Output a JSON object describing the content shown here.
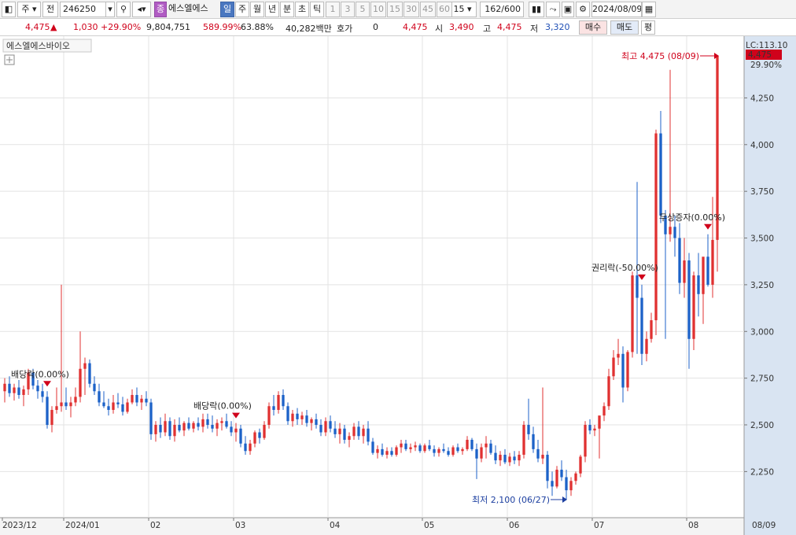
{
  "toolbar": {
    "market": "주",
    "prev": "전",
    "code": "246250",
    "tag": "종",
    "name": "에스엘에스",
    "periods": [
      "일",
      "주",
      "월",
      "년",
      "분",
      "초",
      "틱"
    ],
    "active_period": "일",
    "intervals": [
      "1",
      "3",
      "5",
      "10",
      "15",
      "30",
      "45",
      "60"
    ],
    "interval_select": "15",
    "count": "162/600",
    "date": "2024/08/09"
  },
  "quote": {
    "price": "4,475",
    "change": "1,030",
    "change_pct": "+29.90%",
    "volume": "9,804,751",
    "volume_ratio": "589.99%",
    "turnover": "63.88%",
    "amount": "40,282백만",
    "hoga_label": "호가",
    "hoga_value": "0",
    "last": "4,475",
    "open_label": "시",
    "open": "3,490",
    "high_label": "고",
    "high": "4,475",
    "low_label": "저",
    "low": "3,320",
    "buy_btn": "매수",
    "sell_btn": "매도",
    "flat_btn": "평"
  },
  "chart_title": "에스엘에스바이오",
  "colors": {
    "up": "#e03131",
    "down": "#1c62c8",
    "grid": "#e3e3e3",
    "axis_bg": "#d9e4f2"
  },
  "chart_data": {
    "type": "candlestick",
    "y_ticks": [
      "4,250",
      "4,000",
      "3,750",
      "3,500",
      "3,250",
      "3,000",
      "2,750",
      "2,500",
      "2,250"
    ],
    "y_tick_values": [
      4250,
      4000,
      3750,
      3500,
      3250,
      3000,
      2750,
      2500,
      2250
    ],
    "ylim": [
      2000,
      4500
    ],
    "x_labels": [
      "2023/12",
      "2024/01",
      "02",
      "03",
      "04",
      "05",
      "06",
      "07",
      "08",
      "08/09"
    ],
    "lc_label": "LC:113.10",
    "last_price": "4,475",
    "last_pct": "29.90%",
    "high_note": "최고 4,475 (08/09)",
    "low_note": "최저 2,100 (06/27)",
    "events": [
      {
        "label": "배당락(0.00%)",
        "date": "2023/12/27"
      },
      {
        "label": "배당락(0.00%)",
        "date": "2024/02/28"
      },
      {
        "label": "권리락(-50.00%)",
        "date": "2024/07/17"
      },
      {
        "label": "무상증자(0.00%)",
        "date": "2024/08/05"
      }
    ],
    "months": [
      "2023/12",
      "2024/01",
      "02",
      "03",
      "04",
      "05",
      "06",
      "07",
      "08"
    ],
    "ohlc": [
      [
        2680,
        2750,
        2620,
        2720
      ],
      [
        2720,
        2760,
        2650,
        2670
      ],
      [
        2670,
        2720,
        2630,
        2700
      ],
      [
        2700,
        2740,
        2640,
        2660
      ],
      [
        2660,
        2710,
        2600,
        2690
      ],
      [
        2690,
        2800,
        2660,
        2780
      ],
      [
        2780,
        2800,
        2690,
        2710
      ],
      [
        2710,
        2740,
        2640,
        2680
      ],
      [
        2680,
        2720,
        2620,
        2650
      ],
      [
        2650,
        2680,
        2480,
        2500
      ],
      [
        2500,
        2600,
        2460,
        2580
      ],
      [
        2580,
        2700,
        2560,
        2600
      ],
      [
        2600,
        3250,
        2570,
        2620
      ],
      [
        2620,
        2700,
        2580,
        2600
      ],
      [
        2600,
        2650,
        2540,
        2620
      ],
      [
        2620,
        2700,
        2600,
        2650
      ],
      [
        2650,
        3000,
        2620,
        2800
      ],
      [
        2800,
        2860,
        2660,
        2830
      ],
      [
        2830,
        2850,
        2700,
        2720
      ],
      [
        2720,
        2760,
        2660,
        2680
      ],
      [
        2680,
        2720,
        2600,
        2620
      ],
      [
        2620,
        2680,
        2590,
        2600
      ],
      [
        2600,
        2640,
        2550,
        2580
      ],
      [
        2580,
        2660,
        2560,
        2620
      ],
      [
        2620,
        2670,
        2590,
        2610
      ],
      [
        2610,
        2650,
        2550,
        2570
      ],
      [
        2570,
        2640,
        2560,
        2620
      ],
      [
        2620,
        2690,
        2610,
        2660
      ],
      [
        2660,
        2700,
        2600,
        2620
      ],
      [
        2620,
        2660,
        2580,
        2640
      ],
      [
        2640,
        2680,
        2600,
        2620
      ],
      [
        2620,
        2640,
        2420,
        2450
      ],
      [
        2450,
        2520,
        2410,
        2500
      ],
      [
        2500,
        2540,
        2430,
        2460
      ],
      [
        2460,
        2560,
        2440,
        2520
      ],
      [
        2520,
        2540,
        2420,
        2440
      ],
      [
        2440,
        2530,
        2410,
        2500
      ],
      [
        2500,
        2540,
        2460,
        2470
      ],
      [
        2470,
        2520,
        2440,
        2510
      ],
      [
        2510,
        2540,
        2470,
        2480
      ],
      [
        2480,
        2520,
        2460,
        2510
      ],
      [
        2510,
        2540,
        2470,
        2490
      ],
      [
        2490,
        2560,
        2460,
        2530
      ],
      [
        2530,
        2560,
        2480,
        2500
      ],
      [
        2500,
        2550,
        2460,
        2480
      ],
      [
        2480,
        2530,
        2440,
        2510
      ],
      [
        2510,
        2540,
        2470,
        2520
      ],
      [
        2520,
        2560,
        2480,
        2490
      ],
      [
        2490,
        2520,
        2440,
        2460
      ],
      [
        2460,
        2510,
        2410,
        2480
      ],
      [
        2480,
        2500,
        2380,
        2400
      ],
      [
        2400,
        2440,
        2340,
        2360
      ],
      [
        2360,
        2420,
        2340,
        2400
      ],
      [
        2400,
        2470,
        2380,
        2460
      ],
      [
        2460,
        2480,
        2400,
        2430
      ],
      [
        2430,
        2520,
        2420,
        2500
      ],
      [
        2500,
        2620,
        2480,
        2600
      ],
      [
        2600,
        2660,
        2550,
        2580
      ],
      [
        2580,
        2680,
        2560,
        2660
      ],
      [
        2660,
        2690,
        2580,
        2600
      ],
      [
        2600,
        2620,
        2500,
        2520
      ],
      [
        2520,
        2580,
        2490,
        2560
      ],
      [
        2560,
        2590,
        2500,
        2530
      ],
      [
        2530,
        2570,
        2500,
        2550
      ],
      [
        2550,
        2580,
        2490,
        2510
      ],
      [
        2510,
        2540,
        2470,
        2530
      ],
      [
        2530,
        2560,
        2480,
        2500
      ],
      [
        2500,
        2530,
        2440,
        2460
      ],
      [
        2460,
        2540,
        2440,
        2520
      ],
      [
        2520,
        2550,
        2460,
        2480
      ],
      [
        2480,
        2520,
        2430,
        2450
      ],
      [
        2450,
        2510,
        2400,
        2480
      ],
      [
        2480,
        2500,
        2400,
        2420
      ],
      [
        2420,
        2460,
        2380,
        2440
      ],
      [
        2440,
        2510,
        2420,
        2490
      ],
      [
        2490,
        2520,
        2420,
        2440
      ],
      [
        2440,
        2500,
        2400,
        2480
      ],
      [
        2480,
        2520,
        2390,
        2410
      ],
      [
        2410,
        2430,
        2340,
        2350
      ],
      [
        2350,
        2390,
        2320,
        2370
      ],
      [
        2370,
        2400,
        2330,
        2340
      ],
      [
        2340,
        2380,
        2320,
        2360
      ],
      [
        2360,
        2380,
        2330,
        2340
      ],
      [
        2340,
        2390,
        2330,
        2380
      ],
      [
        2380,
        2420,
        2350,
        2400
      ],
      [
        2400,
        2420,
        2360,
        2370
      ],
      [
        2370,
        2400,
        2350,
        2380
      ],
      [
        2380,
        2410,
        2360,
        2390
      ],
      [
        2390,
        2400,
        2350,
        2360
      ],
      [
        2360,
        2400,
        2350,
        2390
      ],
      [
        2390,
        2420,
        2360,
        2370
      ],
      [
        2370,
        2390,
        2330,
        2350
      ],
      [
        2350,
        2380,
        2330,
        2370
      ],
      [
        2370,
        2400,
        2350,
        2360
      ],
      [
        2360,
        2380,
        2330,
        2340
      ],
      [
        2340,
        2390,
        2330,
        2380
      ],
      [
        2380,
        2400,
        2350,
        2360
      ],
      [
        2360,
        2380,
        2340,
        2370
      ],
      [
        2370,
        2440,
        2360,
        2420
      ],
      [
        2420,
        2430,
        2360,
        2370
      ],
      [
        2370,
        2400,
        2210,
        2320
      ],
      [
        2320,
        2400,
        2300,
        2380
      ],
      [
        2380,
        2440,
        2320,
        2400
      ],
      [
        2400,
        2420,
        2340,
        2350
      ],
      [
        2350,
        2390,
        2290,
        2310
      ],
      [
        2310,
        2360,
        2280,
        2340
      ],
      [
        2340,
        2370,
        2290,
        2300
      ],
      [
        2300,
        2350,
        2280,
        2330
      ],
      [
        2330,
        2360,
        2290,
        2310
      ],
      [
        2310,
        2360,
        2280,
        2340
      ],
      [
        2340,
        2520,
        2320,
        2500
      ],
      [
        2500,
        2640,
        2420,
        2450
      ],
      [
        2450,
        2490,
        2350,
        2370
      ],
      [
        2370,
        2420,
        2300,
        2320
      ],
      [
        2320,
        2700,
        2290,
        2340
      ],
      [
        2340,
        2360,
        2160,
        2200
      ],
      [
        2200,
        2250,
        2120,
        2170
      ],
      [
        2170,
        2280,
        2160,
        2260
      ],
      [
        2260,
        2310,
        2200,
        2220
      ],
      [
        2220,
        2260,
        2100,
        2150
      ],
      [
        2150,
        2220,
        2120,
        2200
      ],
      [
        2200,
        2250,
        2180,
        2240
      ],
      [
        2240,
        2340,
        2220,
        2330
      ],
      [
        2330,
        2520,
        2300,
        2500
      ],
      [
        2500,
        2530,
        2450,
        2470
      ],
      [
        2470,
        2500,
        2440,
        2480
      ],
      [
        2480,
        2500,
        2320,
        2550
      ],
      [
        2550,
        2620,
        2520,
        2600
      ],
      [
        2600,
        2800,
        2580,
        2760
      ],
      [
        2760,
        2900,
        2740,
        2860
      ],
      [
        2860,
        2960,
        2820,
        2880
      ],
      [
        2880,
        2920,
        2620,
        2700
      ],
      [
        2700,
        2900,
        2680,
        2890
      ],
      [
        2890,
        3320,
        2860,
        3300
      ],
      [
        3300,
        3800,
        2880,
        3180
      ],
      [
        3180,
        3250,
        2820,
        2880
      ],
      [
        2880,
        3000,
        2840,
        2960
      ],
      [
        2960,
        3100,
        2940,
        3060
      ],
      [
        3060,
        4080,
        2980,
        4060
      ],
      [
        4060,
        4180,
        3580,
        3620
      ],
      [
        3620,
        3650,
        2960,
        3520
      ],
      [
        3520,
        4400,
        3480,
        3560
      ],
      [
        3560,
        3620,
        3400,
        3500
      ],
      [
        3500,
        3580,
        3200,
        3260
      ],
      [
        3260,
        3500,
        3180,
        3380
      ],
      [
        3380,
        3420,
        2800,
        2960
      ],
      [
        2960,
        3320,
        2900,
        3300
      ],
      [
        3300,
        3420,
        3080,
        3200
      ],
      [
        3200,
        3380,
        3040,
        3400
      ],
      [
        3400,
        3520,
        3240,
        3250
      ],
      [
        3250,
        3720,
        3180,
        3490
      ],
      [
        3490,
        4475,
        3320,
        4475
      ]
    ]
  }
}
